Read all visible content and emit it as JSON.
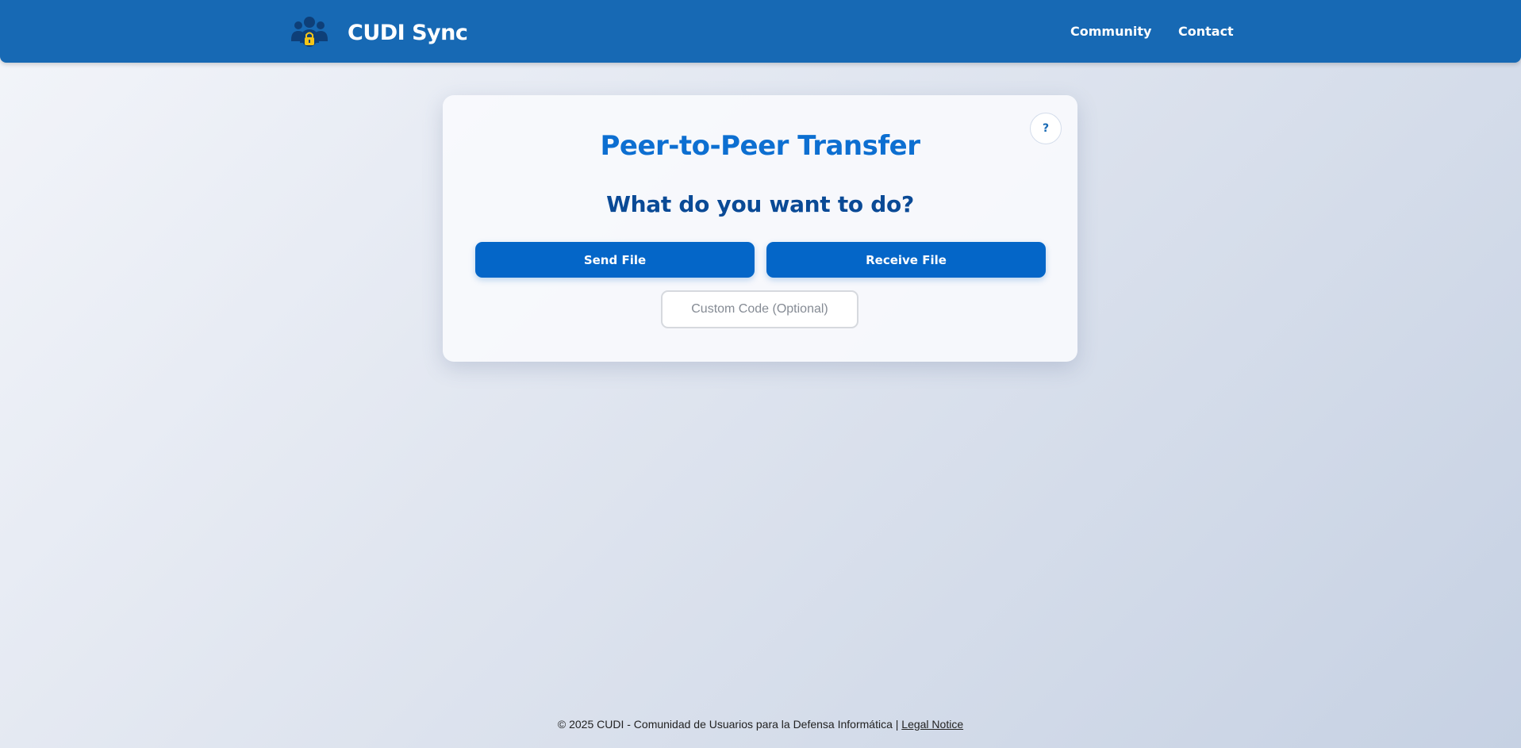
{
  "header": {
    "brand_name": "CUDI Sync",
    "logo_icon": "users-lock-icon",
    "nav": [
      {
        "label": "Community"
      },
      {
        "label": "Contact"
      }
    ],
    "colors": {
      "header_bg": "#1769b4",
      "nav_text": "#ffffff"
    }
  },
  "card": {
    "help_label": "?",
    "title": "Peer-to-Peer Transfer",
    "question": "What do you want to do?",
    "send_label": "Send File",
    "receive_label": "Receive File",
    "code_placeholder": "Custom Code (Optional)",
    "code_value": "",
    "colors": {
      "title": "#0d6fd1",
      "question": "#0a4a96",
      "button_bg": "#0466c8"
    }
  },
  "footer": {
    "copyright": "© 2025 CUDI - Comunidad de Usuarios para la Defensa Informática | ",
    "legal_link": "Legal Notice"
  }
}
